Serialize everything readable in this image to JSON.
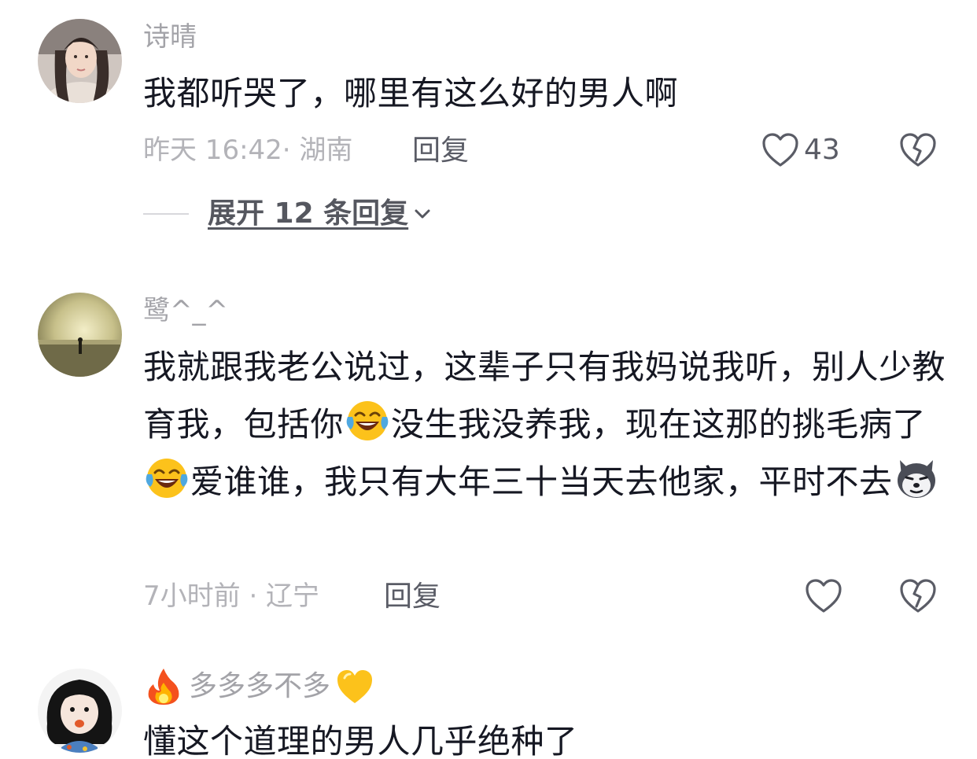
{
  "comments": [
    {
      "username": "诗晴",
      "text": "我都听哭了，哪里有这么好的男人啊",
      "time_location": "昨天 16:42· 湖南",
      "reply_label": "回复",
      "like_count": "43",
      "expand_label": "展开 12 条回复"
    },
    {
      "username": "鹭^_^",
      "text_part1": "我就跟我老公说过，这辈子只有我妈说我听，别人少教育我，包括你",
      "text_part2": "没生我没养我，现在这那的挑毛病了",
      "text_part3": "爱谁谁，我只有大年三十当天去他家，平时不去",
      "time_location": "7小时前 · 辽宁",
      "reply_label": "回复"
    },
    {
      "username": "多多多不多",
      "text": "懂这个道理的男人几乎绝种了"
    }
  ],
  "icons": {
    "like": "heart-outline-icon",
    "dislike": "broken-heart-icon",
    "expand": "chevron-down-icon",
    "emoji_cry_laugh": "tears-of-joy-emoji",
    "emoji_dog": "husky-dog-emoji",
    "emoji_fire": "fire-emoji",
    "emoji_heart": "yellow-heart-emoji"
  },
  "colors": {
    "text": "#161823",
    "muted": "#a3a3a8",
    "action": "#5a5c66"
  }
}
